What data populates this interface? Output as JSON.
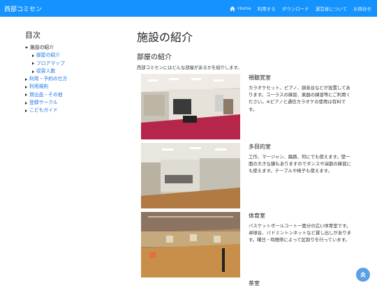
{
  "nav": {
    "brand": "西部コミセン",
    "links": [
      "Home",
      "利用する",
      "ダウンロード",
      "運営者について",
      "お問合せ"
    ]
  },
  "toc": {
    "title": "目次",
    "items": [
      {
        "label": "施設の紹介",
        "level": 0,
        "expanded": true,
        "link": false
      },
      {
        "label": "部屋の紹介",
        "level": 1,
        "expanded": false,
        "link": true
      },
      {
        "label": "フロアマップ",
        "level": 1,
        "expanded": false,
        "link": true
      },
      {
        "label": "収容人数",
        "level": 1,
        "expanded": false,
        "link": true
      },
      {
        "label": "利用・予約の仕方",
        "level": 0,
        "expanded": false,
        "link": true
      },
      {
        "label": "利用規則",
        "level": 0,
        "expanded": false,
        "link": true
      },
      {
        "label": "貸出品・その他",
        "level": 0,
        "expanded": false,
        "link": true
      },
      {
        "label": "登録サークル",
        "level": 0,
        "expanded": false,
        "link": true
      },
      {
        "label": "こどもガイド",
        "level": 0,
        "expanded": false,
        "link": true
      }
    ]
  },
  "main": {
    "title": "施設の紹介",
    "section_title": "部屋の紹介",
    "intro": "西部コミセンにはどんな部屋があるかを紹介します。",
    "rooms": [
      {
        "name": "視聴覚室",
        "desc": "カラオケセット、ピアノ、調音台などが設置してあります。コーラスの練習、楽器の練習等にご利用ください。※ピアノと通信カラオケの使用は有料です。"
      },
      {
        "name": "多目的室",
        "desc": "工作、マージャン、踊路、何にでも使えます。壁一面の大きな鏡もありますのでダンスや演劇の練習にも使えます。テーブルや椅子も使えます。"
      },
      {
        "name": "体育室",
        "desc": "バスケットボールコート一面分の広い体育室です。卓球台、バドミントンネットなど貸し出しがあります。曜日・時間帯によって区割りを行っています。"
      },
      {
        "name": "茶室",
        "desc": ""
      }
    ]
  }
}
